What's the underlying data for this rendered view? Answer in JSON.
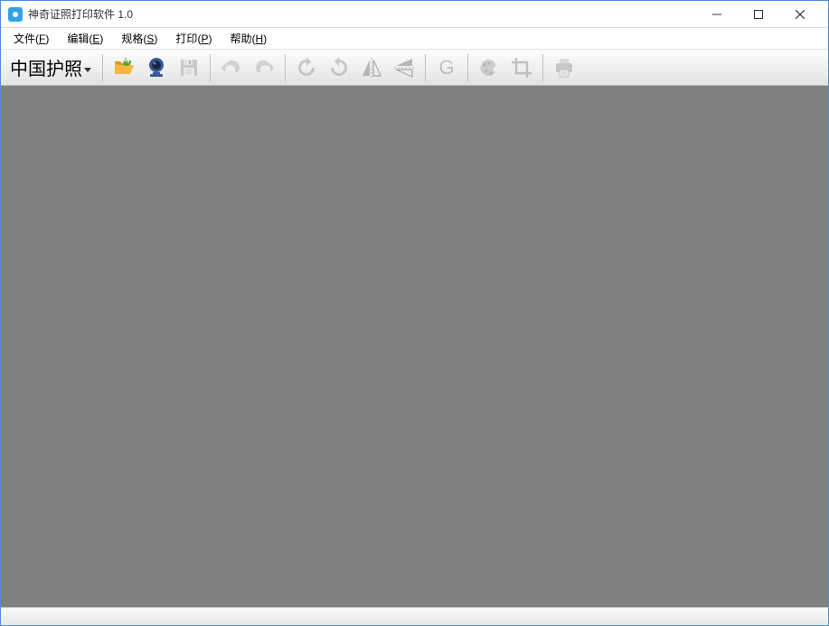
{
  "titlebar": {
    "app_title": "神奇证照打印软件 1.0"
  },
  "menubar": {
    "file": {
      "label": "文件",
      "accel": "F"
    },
    "edit": {
      "label": "编辑",
      "accel": "E"
    },
    "spec": {
      "label": "规格",
      "accel": "S"
    },
    "print": {
      "label": "打印",
      "accel": "P"
    },
    "help": {
      "label": "帮助",
      "accel": "H"
    }
  },
  "toolbar": {
    "photo_type_label": "中国护照"
  }
}
